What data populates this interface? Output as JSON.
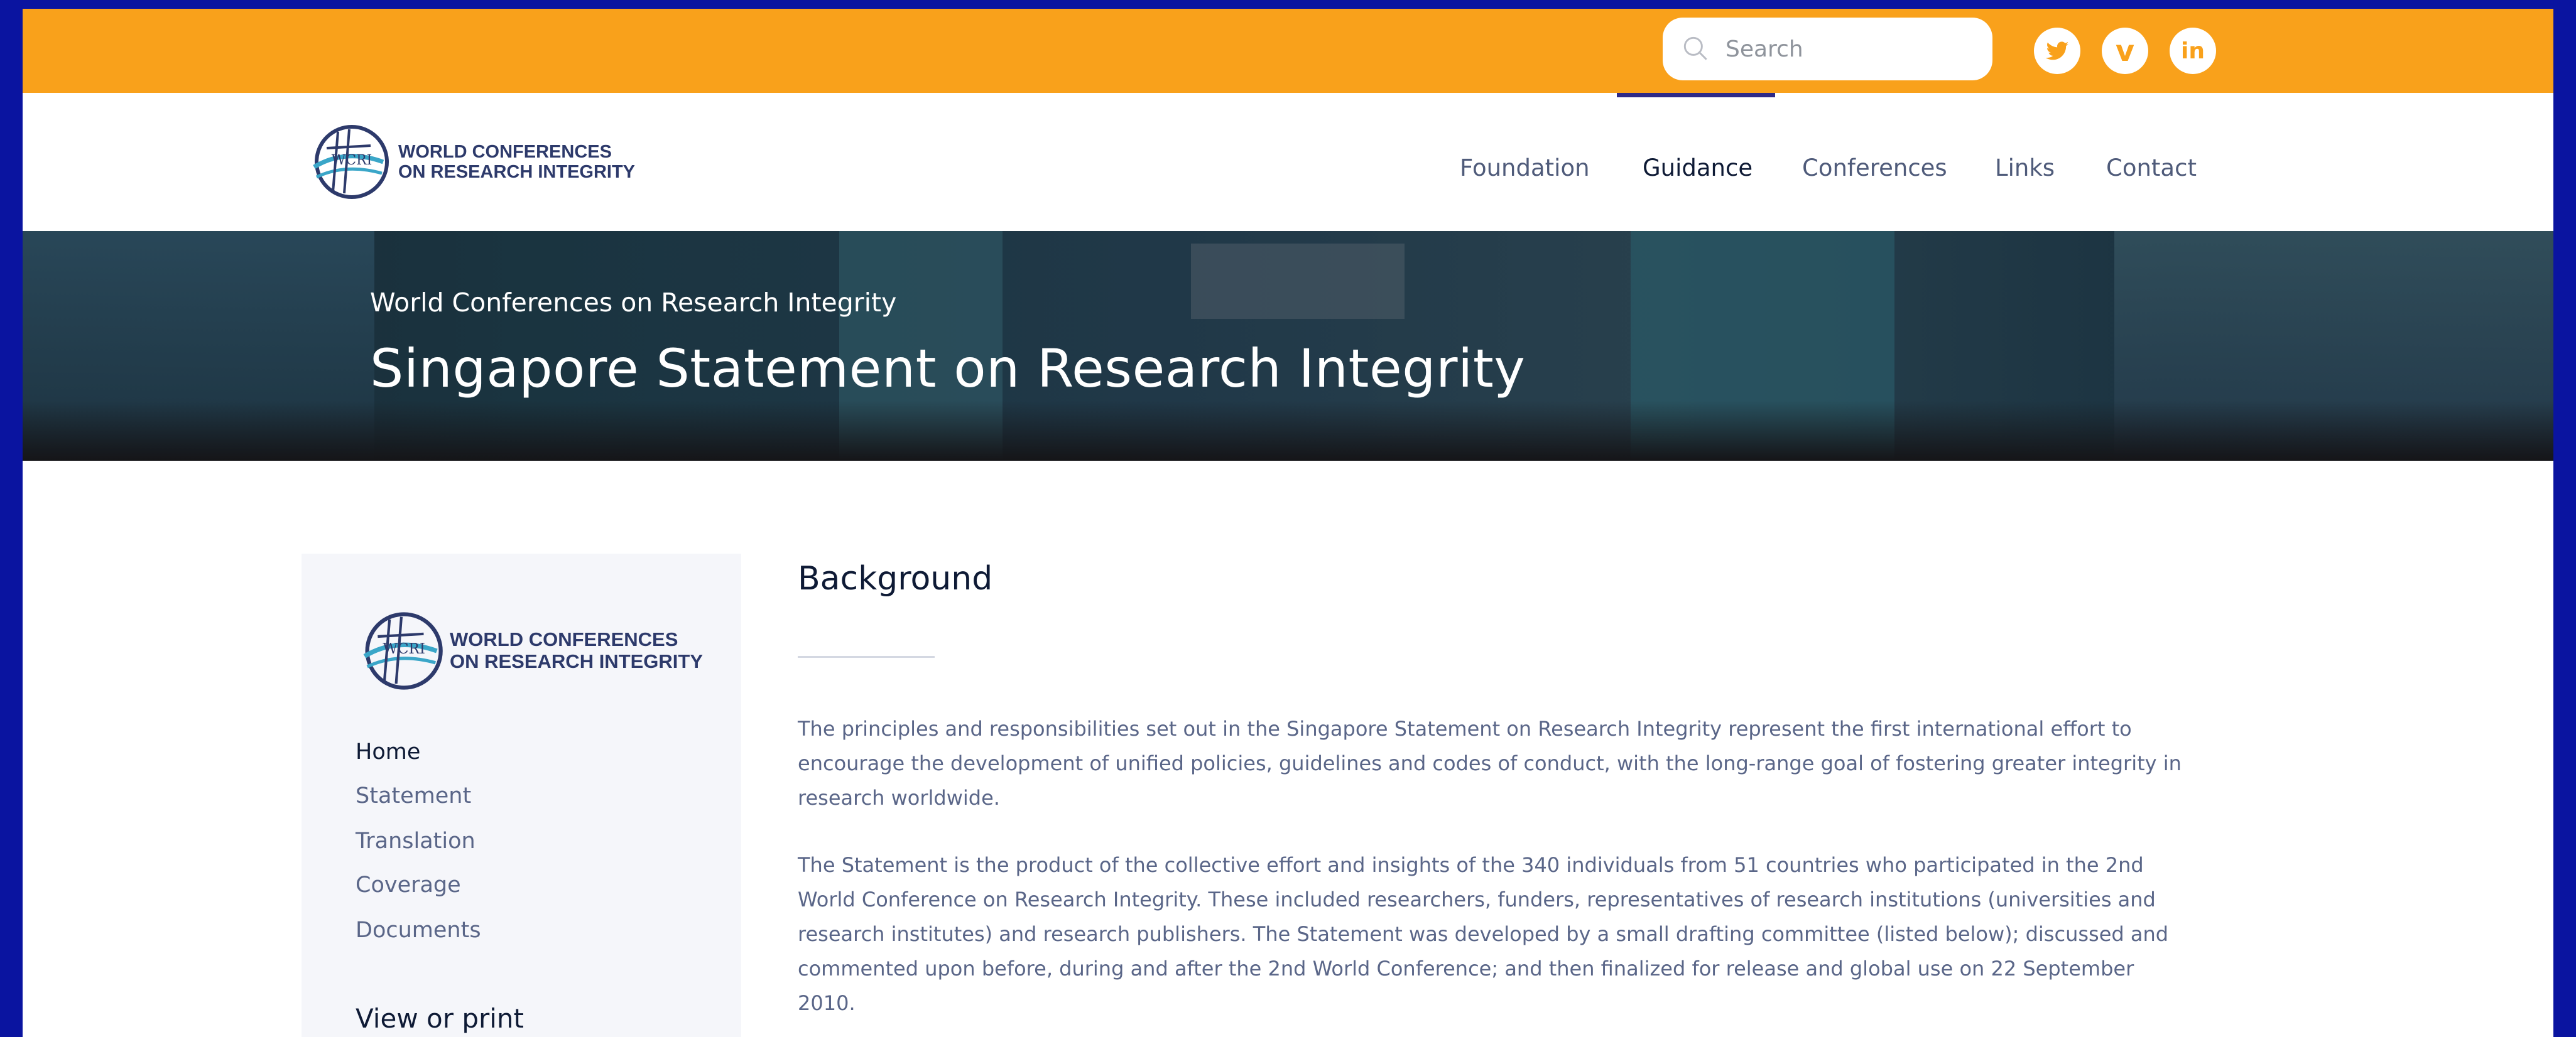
{
  "topbar": {
    "search_placeholder": "Search",
    "social": [
      {
        "icon": "twitter-icon",
        "glyph": "t"
      },
      {
        "icon": "vimeo-icon",
        "glyph": "v"
      },
      {
        "icon": "linkedin-icon",
        "glyph": "in"
      }
    ],
    "color": "#f9a11b"
  },
  "logo": {
    "line1": "WORLD CONFERENCES",
    "line2": "ON RESEARCH INTEGRITY",
    "emblem_text": "WCRI"
  },
  "nav": {
    "items": [
      "Foundation",
      "Guidance",
      "Conferences",
      "Links",
      "Contact"
    ],
    "active": "Guidance"
  },
  "hero": {
    "subtitle": "World Conferences on Research Integrity",
    "title": "Singapore Statement on Research Integrity"
  },
  "sidebar": {
    "links": [
      "Home",
      "Statement",
      "Translation",
      "Coverage",
      "Documents"
    ],
    "active": "Home",
    "heading": "View or print"
  },
  "main": {
    "title": "Background",
    "paragraphs": [
      {
        "lines": [
          "The principles and responsibilities set out in the Singapore Statement on Research Integrity represent the first international effort to",
          "encourage the development of unified policies, guidelines and codes of conduct, with the long-range goal of fostering greater integrity in",
          "research worldwide."
        ]
      },
      {
        "lines": [
          "The Statement is the product of the collective effort and insights of the 340 individuals from 51 countries who participated in the 2nd",
          "World Conference on Research Integrity. These included researchers, funders, representatives of research institutions (universities and",
          "research institutes) and research publishers. The Statement was developed by a small drafting committee (listed below); discussed and",
          "commented upon before, during and after the 2nd World Conference; and then finalized for release and global use on 22 September",
          "2010."
        ]
      }
    ]
  }
}
